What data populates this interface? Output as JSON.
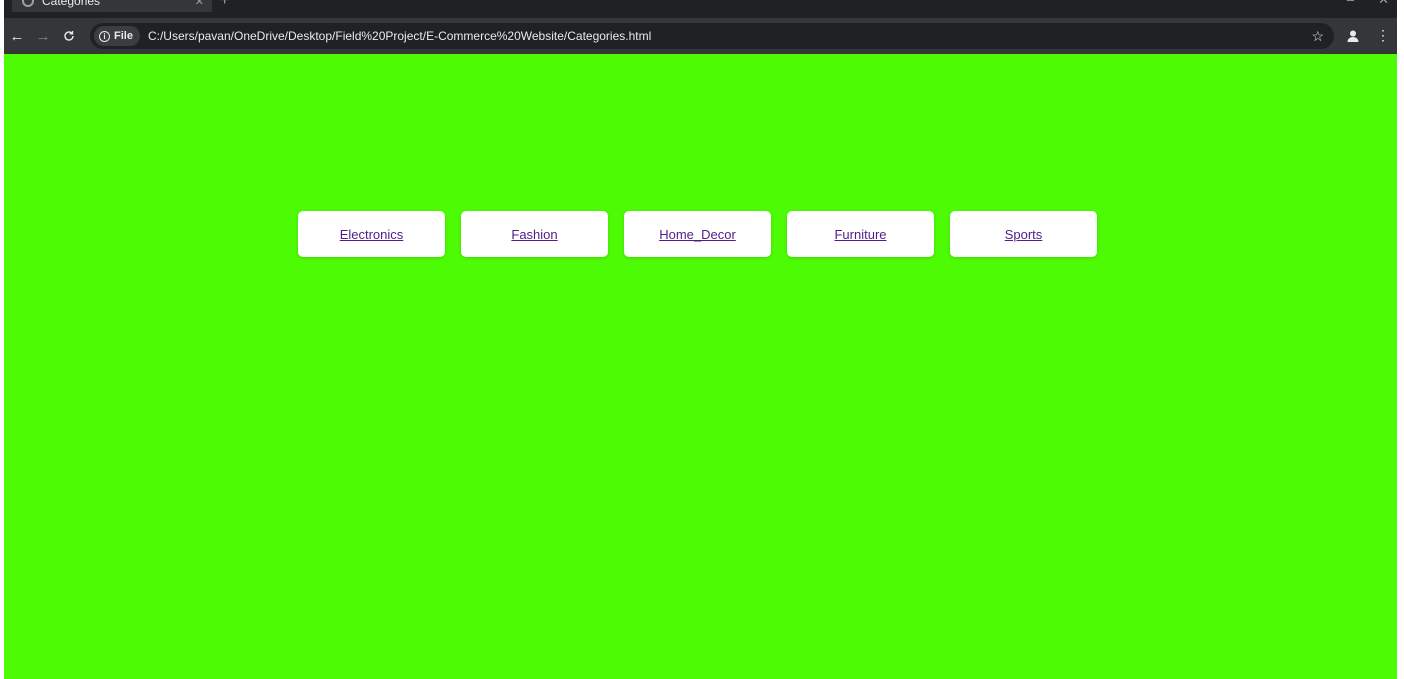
{
  "browser": {
    "tab": {
      "title": "Categories",
      "close_glyph": "✕"
    },
    "new_tab_glyph": "+",
    "window_controls": [
      "–",
      "✕"
    ],
    "toolbar": {
      "back_glyph": "←",
      "forward_glyph": "→",
      "reload_glyph": "C",
      "chip_label": "File",
      "url": "C:/Users/pavan/OneDrive/Desktop/Field%20Project/E-Commerce%20Website/Categories.html",
      "star_glyph": "☆",
      "menu_glyph": "⋮"
    }
  },
  "page": {
    "background_color": "#4dfb04",
    "categories": [
      {
        "label": "Electronics"
      },
      {
        "label": "Fashion"
      },
      {
        "label": "Home_Decor"
      },
      {
        "label": "Furniture"
      },
      {
        "label": "Sports"
      }
    ]
  }
}
